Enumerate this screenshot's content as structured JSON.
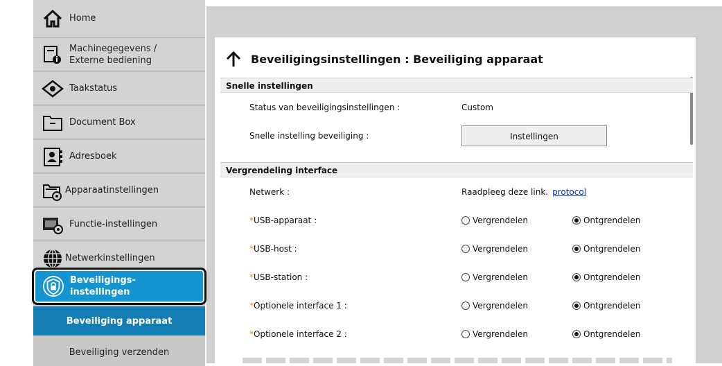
{
  "sidebar": {
    "items": [
      {
        "label": "Home",
        "icon": "home-icon"
      },
      {
        "label": "Machinegegevens /",
        "label2": "Externe bediening",
        "icon": "machine-info-icon"
      },
      {
        "label": "Taakstatus",
        "icon": "eye-icon"
      },
      {
        "label": "Document Box",
        "icon": "folder-icon"
      },
      {
        "label": "Adresboek",
        "icon": "address-book-icon"
      },
      {
        "label": "Apparaatinstellingen",
        "icon": "device-settings-icon"
      },
      {
        "label": "Functie-instellingen",
        "icon": "function-settings-icon"
      },
      {
        "label": "Netwerkinstellingen",
        "icon": "globe-icon"
      },
      {
        "label": "Beveiligings-",
        "label2": "instellingen",
        "icon": "shield-icon"
      }
    ],
    "subitems": [
      {
        "label": "Beveiliging apparaat"
      },
      {
        "label": "Beveiliging verzenden"
      }
    ]
  },
  "page": {
    "title": "Beveiligingsinstellingen : Beveiliging apparaat"
  },
  "sections": {
    "quick": {
      "header": "Snelle instellingen",
      "status_label": "Status van beveiligingsinstellingen :",
      "status_value": "Custom",
      "quick_label": "Snelle instelling beveiliging :",
      "quick_button": "Instellingen"
    },
    "lock": {
      "header": "Vergrendeling interface",
      "network_label": "Netwerk :",
      "network_text": "Raadpleeg deze link.",
      "network_link": "protocol",
      "lock_option": "Vergrendelen",
      "unlock_option": "Ontgrendelen",
      "rows": [
        {
          "star": "*",
          "label": "USB-apparaat :",
          "selected": "Ontgrendelen"
        },
        {
          "star": "*",
          "label": "USB-host :",
          "selected": "Ontgrendelen"
        },
        {
          "star": "*",
          "label": "USB-station :",
          "selected": "Ontgrendelen"
        },
        {
          "star": "*",
          "label": "Optionele interface 1 :",
          "selected": "Ontgrendelen"
        },
        {
          "star": "*",
          "label": "Optionele interface 2 :",
          "selected": "Ontgrendelen"
        }
      ]
    }
  },
  "colors": {
    "selected_nav": "#1495d1",
    "active_sub": "#147db3",
    "required_star": "#e8901c",
    "link": "#0033cc"
  }
}
